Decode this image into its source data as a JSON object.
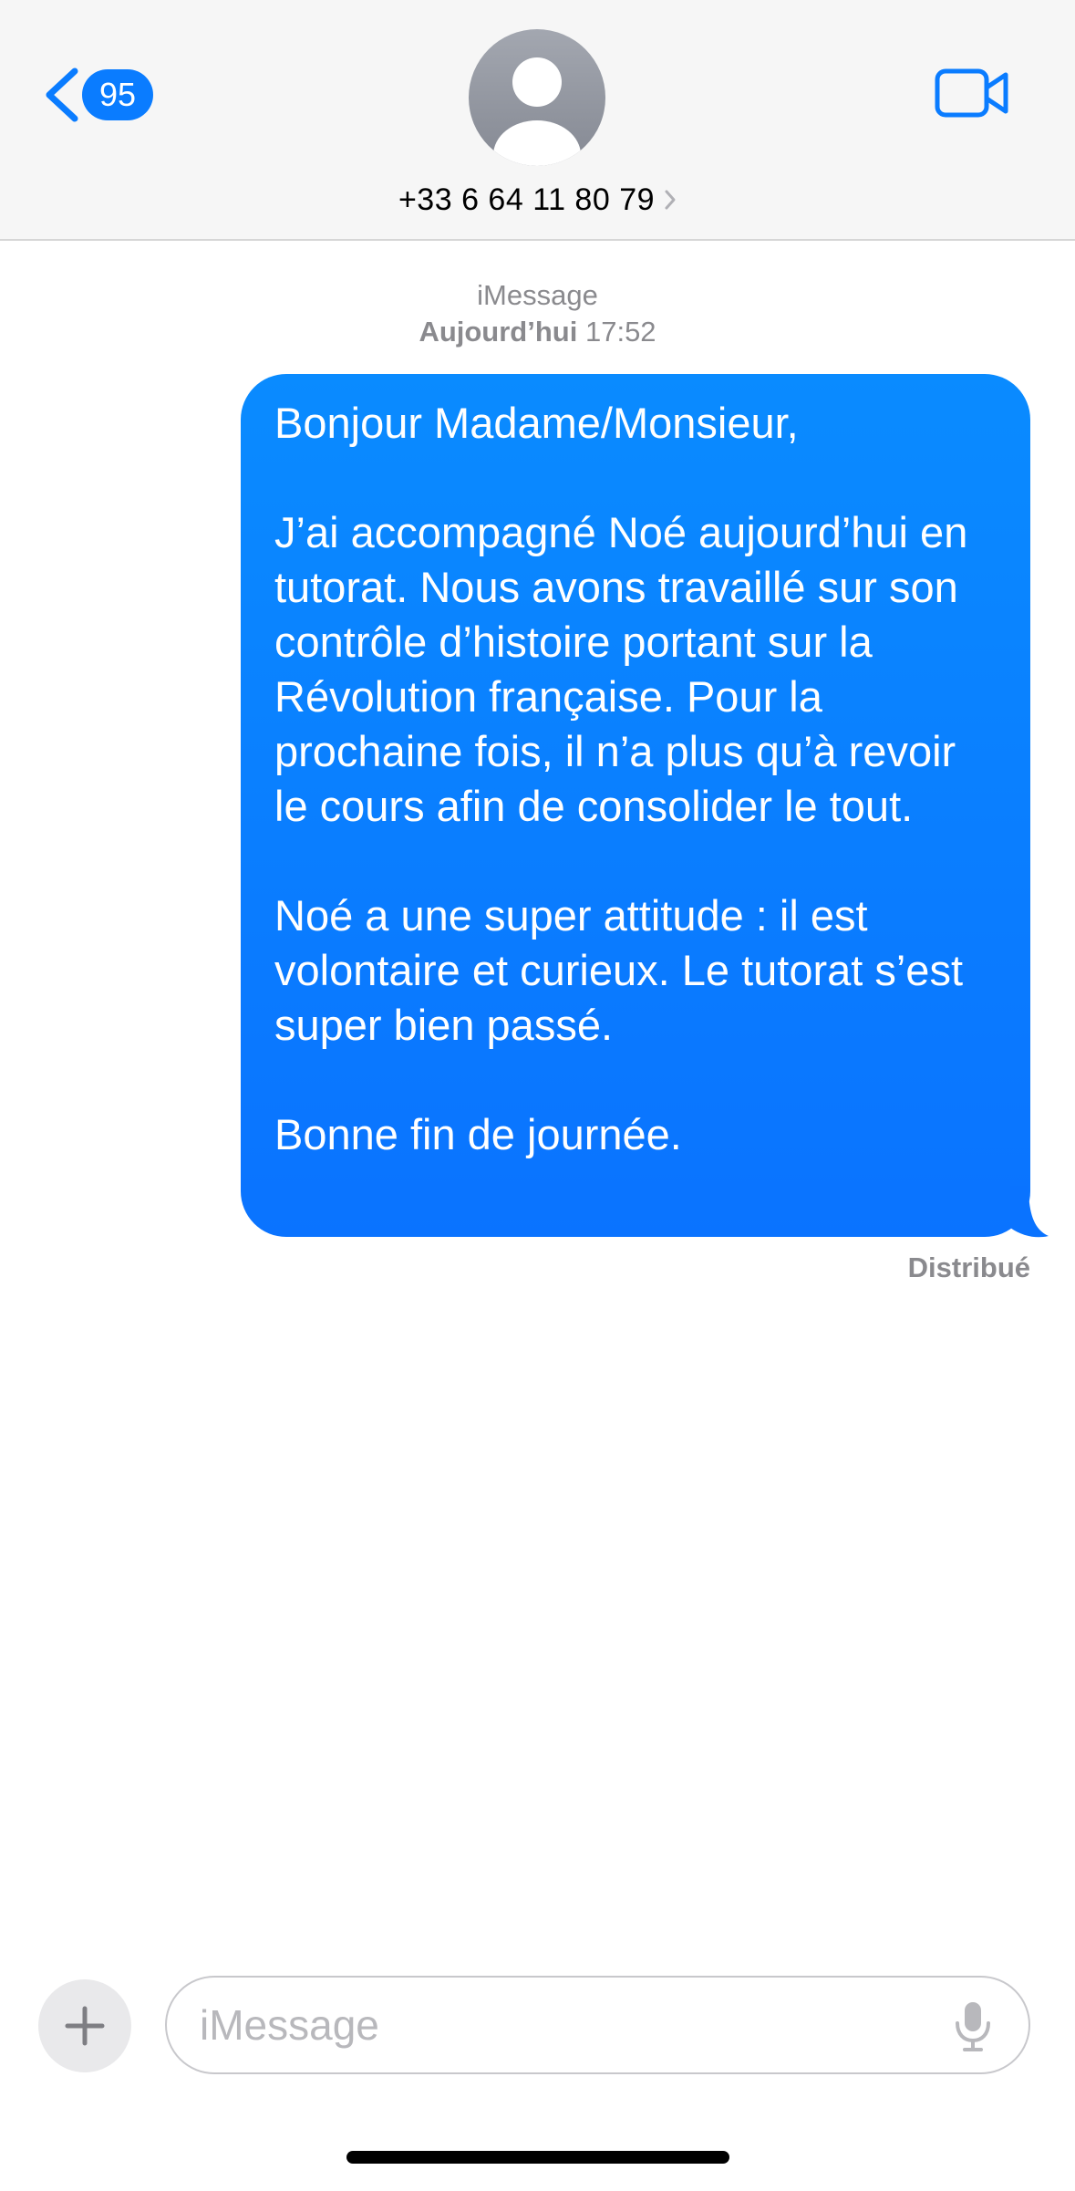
{
  "header": {
    "back_badge_count": "95",
    "contact_name": "+33 6 64 11 80 79"
  },
  "conversation": {
    "service_label": "iMessage",
    "day_label": "Aujourd’hui",
    "time_label": "17:52",
    "message": {
      "paragraphs": [
        "Bonjour Madame/Monsieur,",
        "J’ai accompagné Noé aujourd’hui en tutorat. Nous avons travaillé sur son contrôle d’histoire portant sur la Révolution française. Pour la prochaine fois, il n’a plus qu’à revoir le cours afin de consolider le tout.",
        "Noé a une super attitude : il est volontaire et curieux. Le tutorat s’est super bien passé.",
        "Bonne fin de journée."
      ],
      "status": "Distribué"
    }
  },
  "composer": {
    "placeholder": "iMessage",
    "value": ""
  },
  "icons": {
    "back": "chevron-left-icon",
    "avatar": "person-placeholder-icon",
    "contact_disclosure": "chevron-right-icon",
    "video": "video-camera-icon",
    "plus": "plus-icon",
    "mic": "microphone-icon"
  },
  "colors": {
    "accent": "#0a7cff",
    "bubble_top": "#0a8bff",
    "bubble_bottom": "#0a73ff",
    "header_bg": "#f6f6f6",
    "meta_text": "#8a8a8e"
  }
}
